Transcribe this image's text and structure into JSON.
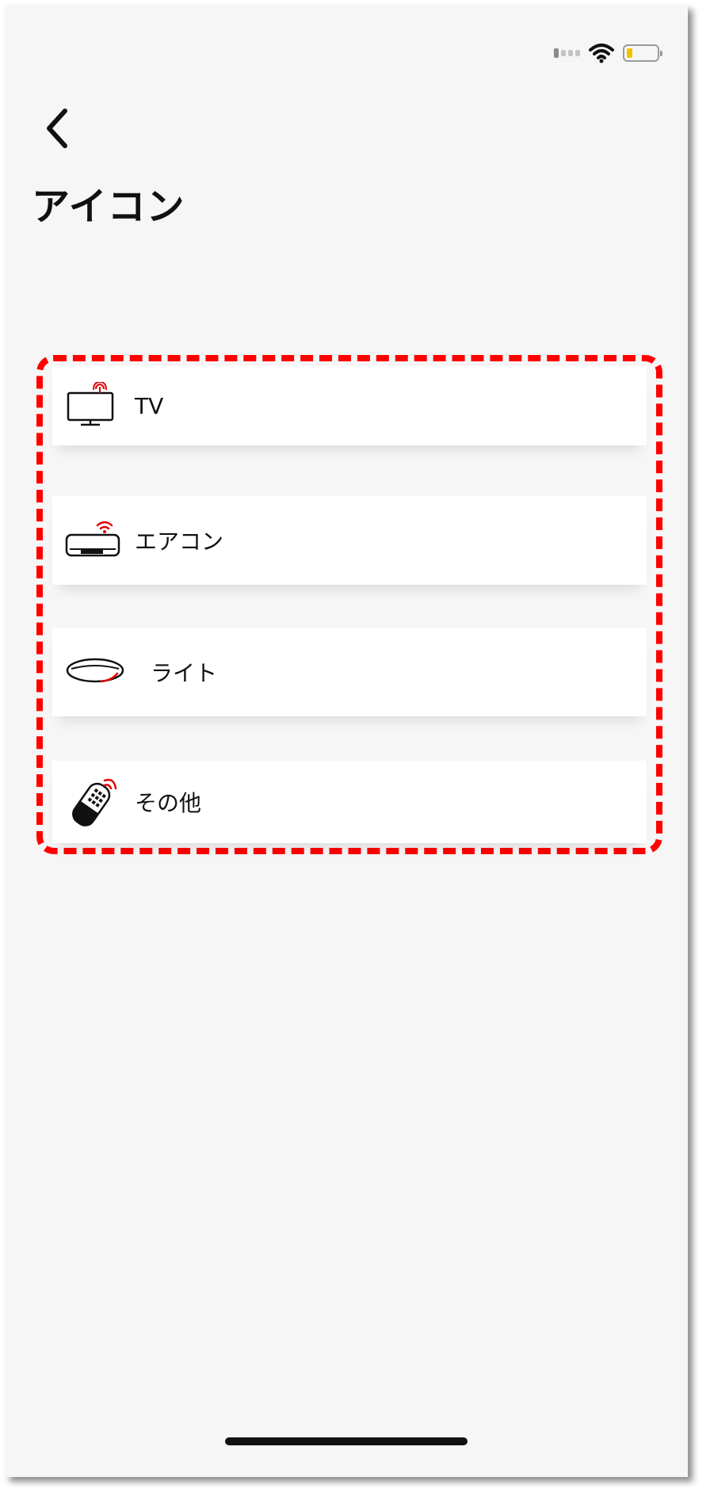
{
  "screen": {
    "title": "アイコン"
  },
  "status_bar": {
    "battery_level_fraction": 0.2,
    "battery_color": "#f3c300",
    "signal_bars_active": 1,
    "wifi_icon": "wifi-icon"
  },
  "nav": {
    "back_icon": "chevron-left-icon"
  },
  "list": {
    "border_color": "#ff0000",
    "items": [
      {
        "label": "TV",
        "icon": "tv-icon"
      },
      {
        "label": "エアコン",
        "icon": "air-conditioner-icon"
      },
      {
        "label": "ライト",
        "icon": "ceiling-light-icon"
      },
      {
        "label": "その他",
        "icon": "remote-control-icon"
      }
    ]
  },
  "colors": {
    "accent": "#e20000",
    "background": "#f6f6f6",
    "card": "#ffffff"
  }
}
